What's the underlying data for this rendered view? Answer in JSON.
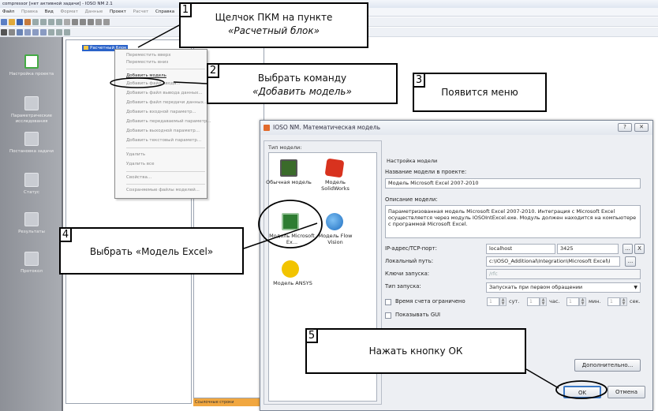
{
  "app": {
    "title": "compressor [нет активной задачи] - IOSO NM 2.1",
    "menu": [
      "Файл",
      "Правка",
      "Вид",
      "Формат",
      "Данные",
      "Проект",
      "Расчет",
      "Справка"
    ]
  },
  "left_panel": {
    "items": [
      {
        "label": "Настройка проекта"
      },
      {
        "label": "Параметрические исследования"
      },
      {
        "label": "Постановка задачи"
      },
      {
        "label": "Статус"
      },
      {
        "label": "Результаты"
      },
      {
        "label": "Протокол"
      }
    ]
  },
  "tree": {
    "node_label": "Расчетный блок"
  },
  "statusbar": {
    "text": "Ссылочные строки"
  },
  "context_menu": {
    "items": [
      {
        "label": "Переместить вверх",
        "enabled": false
      },
      {
        "label": "Переместить вниз",
        "enabled": false
      },
      {
        "label": "Добавить модель",
        "enabled": true
      },
      {
        "label": "Добавить файл ввода...",
        "enabled": false
      },
      {
        "label": "Добавить файл вывода данных...",
        "enabled": false
      },
      {
        "label": "Добавить файл передачи данных...",
        "enabled": false
      },
      {
        "label": "Добавить входной параметр...",
        "enabled": false
      },
      {
        "label": "Добавить передаваемый параметр...",
        "enabled": false
      },
      {
        "label": "Добавить выходной параметр...",
        "enabled": false
      },
      {
        "label": "Добавить текстовый параметр...",
        "enabled": false
      },
      {
        "label": "Удалить",
        "enabled": false
      },
      {
        "label": "Удалить все",
        "enabled": false
      },
      {
        "label": "Свойства...",
        "enabled": false
      },
      {
        "label": "Сохраняемые файлы моделей...",
        "enabled": false
      }
    ]
  },
  "callouts": {
    "c1": {
      "num": "1",
      "line1": "Щелчок ПКМ на пункте",
      "line2": "«Расчетный блок»"
    },
    "c2": {
      "num": "2",
      "line1": "Выбрать команду",
      "line2": "«Добавить модель»"
    },
    "c3": {
      "num": "3",
      "text": "Появится меню"
    },
    "c4": {
      "num": "4",
      "text": "Выбрать «Модель Excel»"
    },
    "c5": {
      "num": "5",
      "text": "Нажать кнопку ОК"
    }
  },
  "dialog": {
    "title": "IOSO NM. Математическая модель",
    "help_btn": "?",
    "close_btn": "✕",
    "type_group_label": "Тип модели:",
    "model_types": [
      {
        "label": "Обычная модель",
        "icon": "calculator-icon",
        "color": "#3a6b2a"
      },
      {
        "label": "Модель SolidWorks",
        "icon": "solidworks-icon",
        "color": "#d8321e"
      },
      {
        "label": "Модель Microsoft Ex...",
        "icon": "excel-icon",
        "color": "#2e7d32"
      },
      {
        "label": "Модель Flow Vision",
        "icon": "flowvision-icon",
        "color": "#1f6fc1"
      },
      {
        "label": "Модель ANSYS",
        "icon": "ansys-icon",
        "color": "#f2c400"
      }
    ],
    "settings": {
      "group_title": "Настройка модели",
      "name_label": "Название модели в проекте:",
      "name_value": "Модель Microsoft Excel 2007-2010",
      "desc_label": "Описание модели:",
      "desc_value": "Параметризованная модель Microsoft Excel 2007-2010. Интеграция с Microsoft Excel осуществляется через модуль IOSOIntExcel.exe. Модуль должен находится на компьютере с программой Microsoft Excel.",
      "ip_label": "IP-адрес/TCP-порт:",
      "ip_value": "localhost",
      "port_value": "3425",
      "browse_btn": "...",
      "x_btn": "X",
      "local_label": "Локальный путь:",
      "local_value": "c:\\IOSO_Additional\\Integration\\Microsoft Excel\\I",
      "keys_label": "Ключи запуска:",
      "keys_value": "/rfc",
      "launch_label": "Тип запуска:",
      "launch_value": "Запускать при первом обращении",
      "time_label": "Время счета ограничено",
      "show_gui_label": "Показывать GUI",
      "spin_value": "1",
      "units": [
        "сут.",
        "час.",
        "мин.",
        "сек."
      ]
    },
    "advanced_btn": "Дополнительно...",
    "ok_btn": "OK",
    "cancel_btn": "Отмена"
  }
}
